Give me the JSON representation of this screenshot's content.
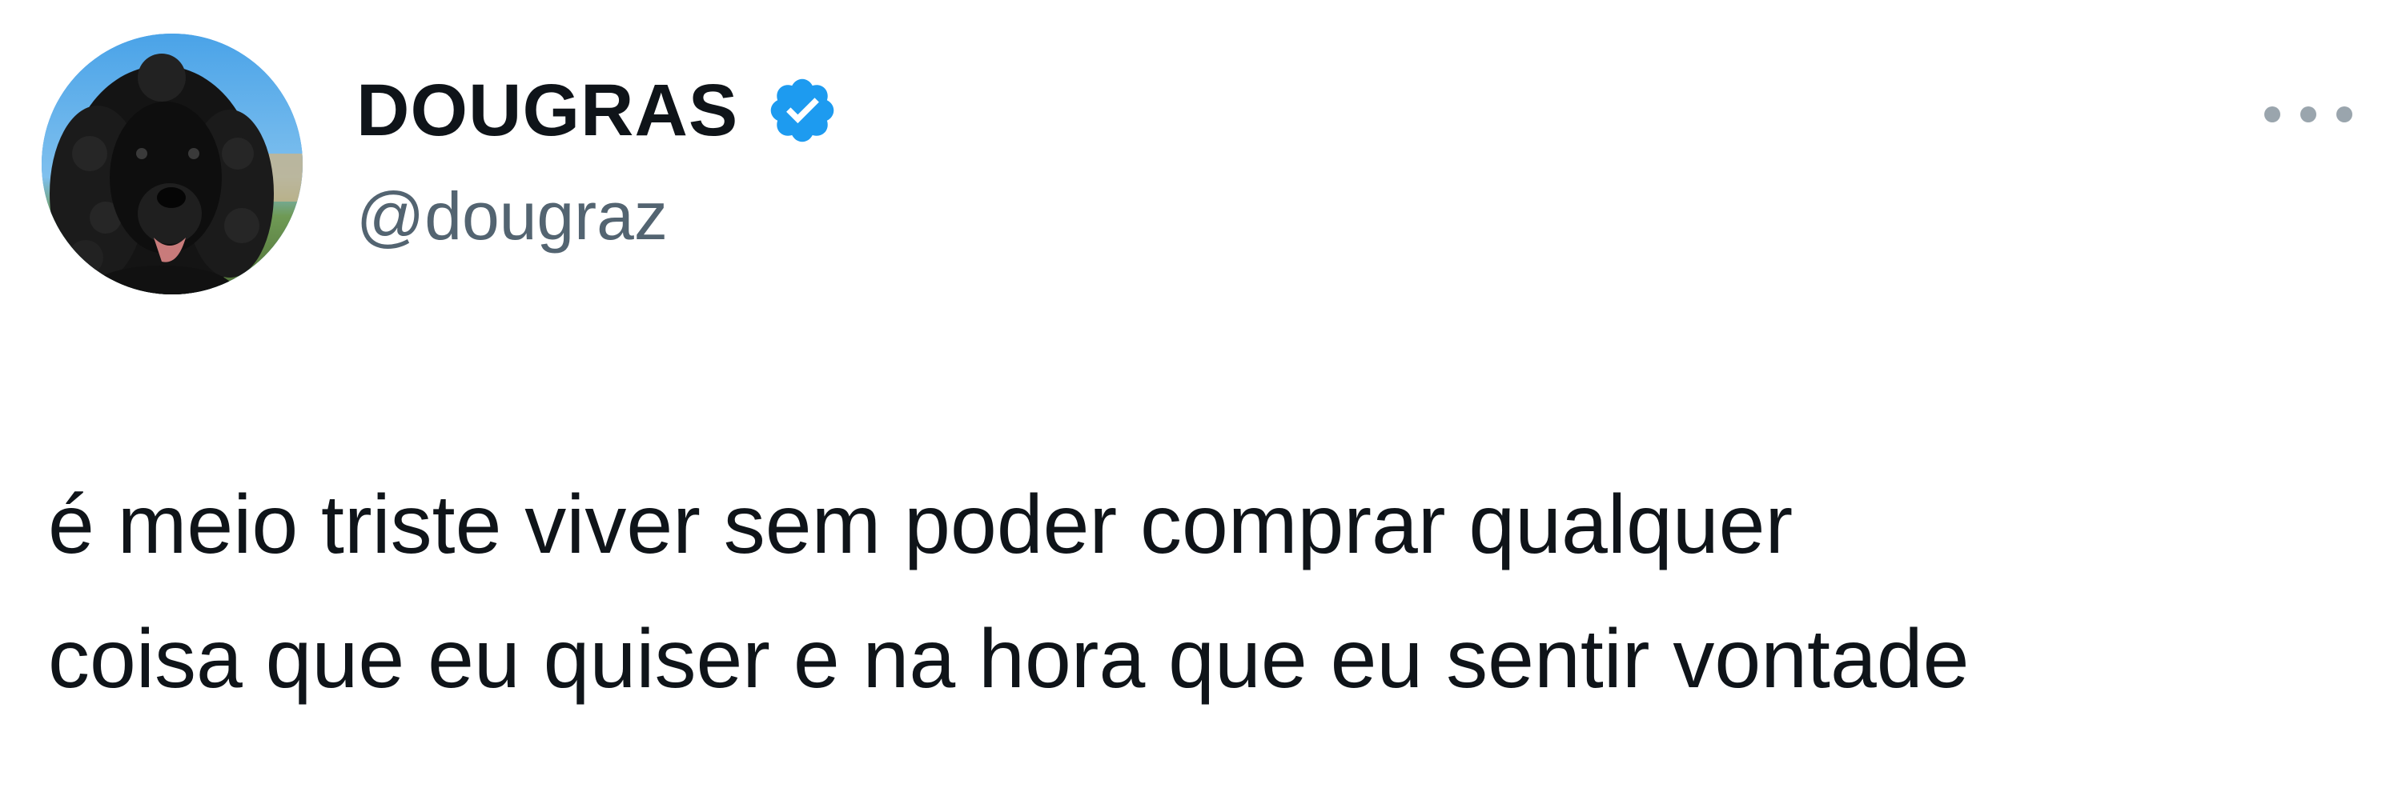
{
  "author": {
    "display_name": "DOUGRAS",
    "handle": "@dougraz",
    "verified": true,
    "avatar": "black-spaniel-dog-photo"
  },
  "tweet": {
    "text_lines": [
      "é meio triste viver sem poder comprar qualquer",
      "coisa que eu quiser e na hora que eu sentir vontade"
    ]
  },
  "icons": {
    "verified": "verified-badge-icon",
    "more": "more-options-icon"
  },
  "colors": {
    "verified_blue": "#1d9bf0",
    "text_primary": "#0f1419",
    "text_secondary": "#536471"
  }
}
